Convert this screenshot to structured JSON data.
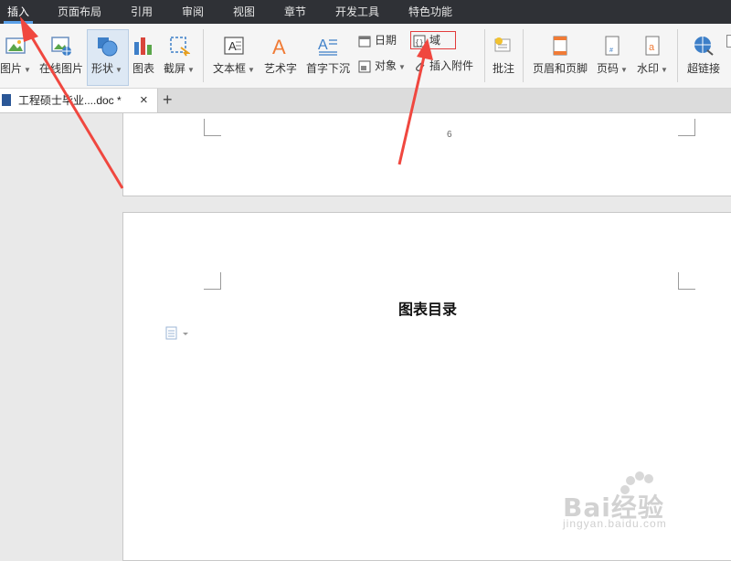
{
  "menu": {
    "tabs": [
      "插入",
      "页面布局",
      "引用",
      "审阅",
      "视图",
      "章节",
      "开发工具",
      "特色功能"
    ],
    "active": "插入"
  },
  "ribbon": {
    "picture": "图片",
    "online_picture": "在线图片",
    "shape": "形状",
    "chart": "图表",
    "screenshot": "截屏",
    "textbox": "文本框",
    "wordart": "艺术字",
    "dropcap": "首字下沉",
    "date": "日期",
    "object": "对象",
    "field": "域",
    "attachment": "插入附件",
    "comment": "批注",
    "header_footer": "页眉和页脚",
    "page_number": "页码",
    "watermark": "水印",
    "hyperlink": "超链接"
  },
  "doc_tab": {
    "name": "工程硕士毕业....doc *",
    "close": "×",
    "new": "+"
  },
  "document": {
    "page_number": "6",
    "title": "图表目录"
  },
  "watermark": {
    "brand": "Bai经验",
    "url": "jingyan.baidu.com"
  },
  "colors": {
    "menubar_bg": "#2f3136",
    "accent": "#5aa0e8",
    "arrow": "#f0473f",
    "highlight_box": "#e23b3b"
  }
}
